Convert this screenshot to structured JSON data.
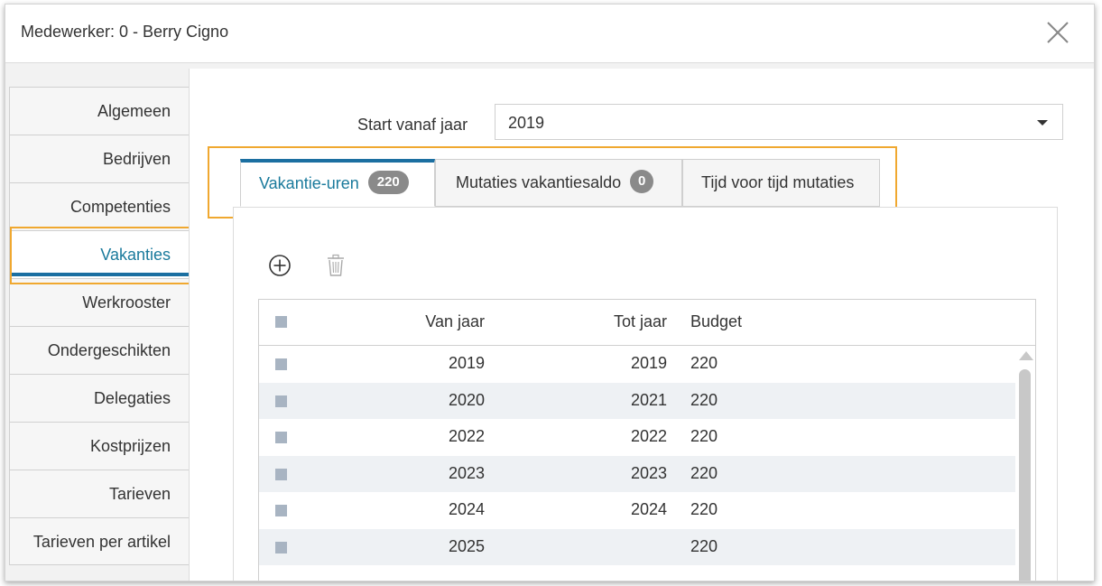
{
  "dialog": {
    "title": "Medewerker: 0 - Berry Cigno",
    "close_icon": "close-icon"
  },
  "side_nav": {
    "items": [
      {
        "label": "Algemeen"
      },
      {
        "label": "Bedrijven"
      },
      {
        "label": "Competenties"
      },
      {
        "label": "Vakanties",
        "active": true
      },
      {
        "label": "Werkrooster"
      },
      {
        "label": "Ondergeschikten"
      },
      {
        "label": "Delegaties"
      },
      {
        "label": "Kostprijzen"
      },
      {
        "label": "Tarieven"
      },
      {
        "label": "Tarieven per artikel"
      }
    ]
  },
  "start_year": {
    "label": "Start vanaf jaar",
    "value": "2019"
  },
  "tabs": [
    {
      "label": "Vakantie-uren",
      "badge": "220",
      "active": true
    },
    {
      "label": "Mutaties vakantiesaldo",
      "badge": "0"
    },
    {
      "label": "Tijd voor tijd mutaties"
    }
  ],
  "toolbar": {
    "add_icon": "plus-circle-icon",
    "delete_icon": "trash-icon"
  },
  "grid": {
    "columns": {
      "van_jaar": "Van jaar",
      "tot_jaar": "Tot jaar",
      "budget": "Budget"
    },
    "rows": [
      {
        "van": "2019",
        "tot": "2019",
        "budget": "220"
      },
      {
        "van": "2020",
        "tot": "2021",
        "budget": "220"
      },
      {
        "van": "2022",
        "tot": "2022",
        "budget": "220"
      },
      {
        "van": "2023",
        "tot": "2023",
        "budget": "220"
      },
      {
        "van": "2024",
        "tot": "2024",
        "budget": "220"
      },
      {
        "van": "2025",
        "tot": "",
        "budget": "220"
      }
    ]
  },
  "colors": {
    "accent": "#1b6fa1",
    "active_text": "#1a7a9c",
    "highlight": "#f0a830",
    "badge": "#8a8a8a"
  }
}
